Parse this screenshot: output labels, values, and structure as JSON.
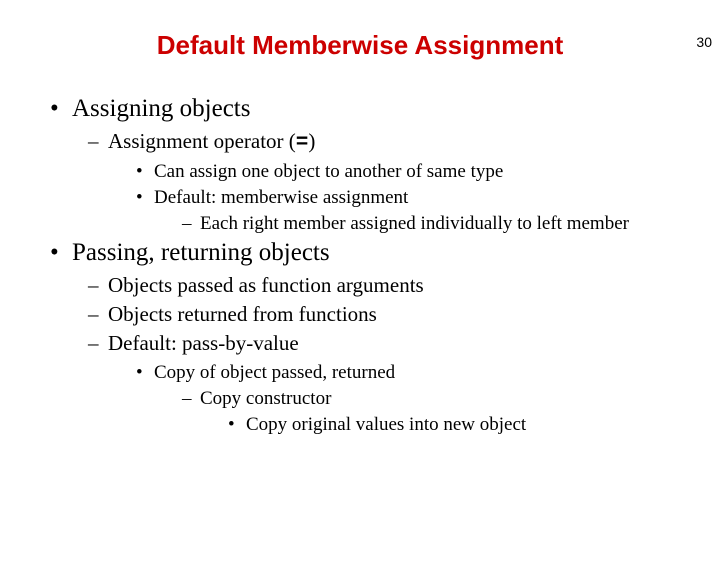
{
  "page_number": "30",
  "title": "Default Memberwise Assignment",
  "b1": {
    "text": "Assigning objects",
    "s1": {
      "pre": "Assignment operator (",
      "op": "=",
      "post": ")",
      "c1": "Can assign one object to another of same type",
      "c2": {
        "text": "Default: memberwise assignment",
        "d1": "Each right member assigned individually to left member"
      }
    }
  },
  "b2": {
    "text": "Passing, returning objects",
    "s1": "Objects passed as function arguments",
    "s2": "Objects returned from functions",
    "s3": {
      "text": "Default: pass-by-value",
      "c1": {
        "text": "Copy of object passed, returned",
        "d1": {
          "text": "Copy constructor",
          "e1": "Copy original values into new object"
        }
      }
    }
  }
}
